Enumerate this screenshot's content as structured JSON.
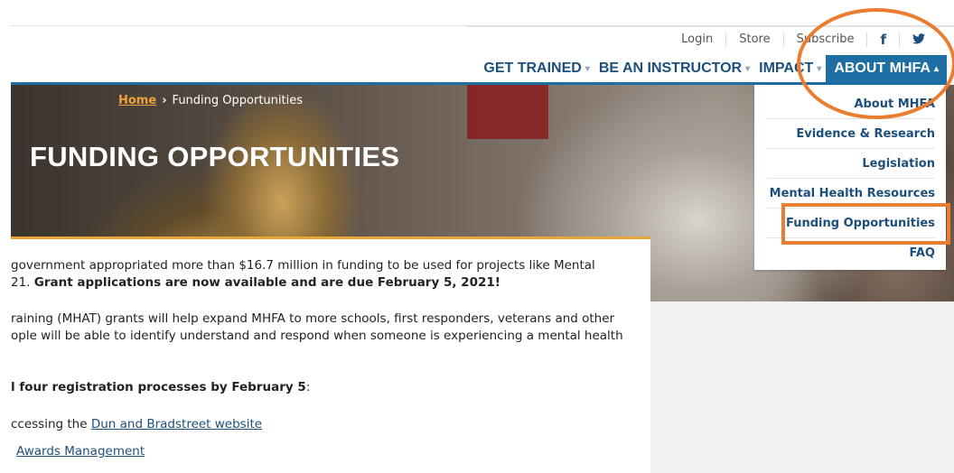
{
  "util_links": [
    "Login",
    "Store",
    "Subscribe"
  ],
  "social": {
    "facebook_glyph": "f",
    "twitter_glyph": "🐦"
  },
  "nav": {
    "items": [
      "GET TRAINED",
      "BE AN INSTRUCTOR",
      "IMPACT"
    ],
    "active": "ABOUT MHFA",
    "caret_down": "▾",
    "caret_up": "▴"
  },
  "breadcrumb": {
    "home": "Home",
    "separator": "›",
    "current": "Funding Opportunities"
  },
  "hero": {
    "title": "FUNDING OPPORTUNITIES"
  },
  "dropdown": {
    "items": [
      "About MHFA",
      "Evidence & Research",
      "Legislation",
      "Mental Health Resources",
      "Funding Opportunities",
      "FAQ"
    ]
  },
  "content": {
    "line1": "government appropriated more than $16.7 million in funding to be used for projects like Mental",
    "line2_prefix": "21. ",
    "line2_bold": "Grant applications are now available and are due February 5, 2021!",
    "line3": "raining (MHAT) grants will help expand MHFA to more schools, first responders, veterans and other",
    "line4": "ople will be able to identify understand and respond when someone is experiencing a mental health",
    "line5_bold": "l four registration processes by February 5",
    "line5_suffix": ":",
    "line6_prefix": "ccessing the ",
    "line6_link": "Dun and Bradstreet website",
    "line7_link": "Awards Management"
  },
  "colors": {
    "brand_blue": "#1d4f7c",
    "nav_active_bg": "#1d6ea3",
    "accent_orange": "#e8a838",
    "annotation": "#ea7d2f"
  }
}
